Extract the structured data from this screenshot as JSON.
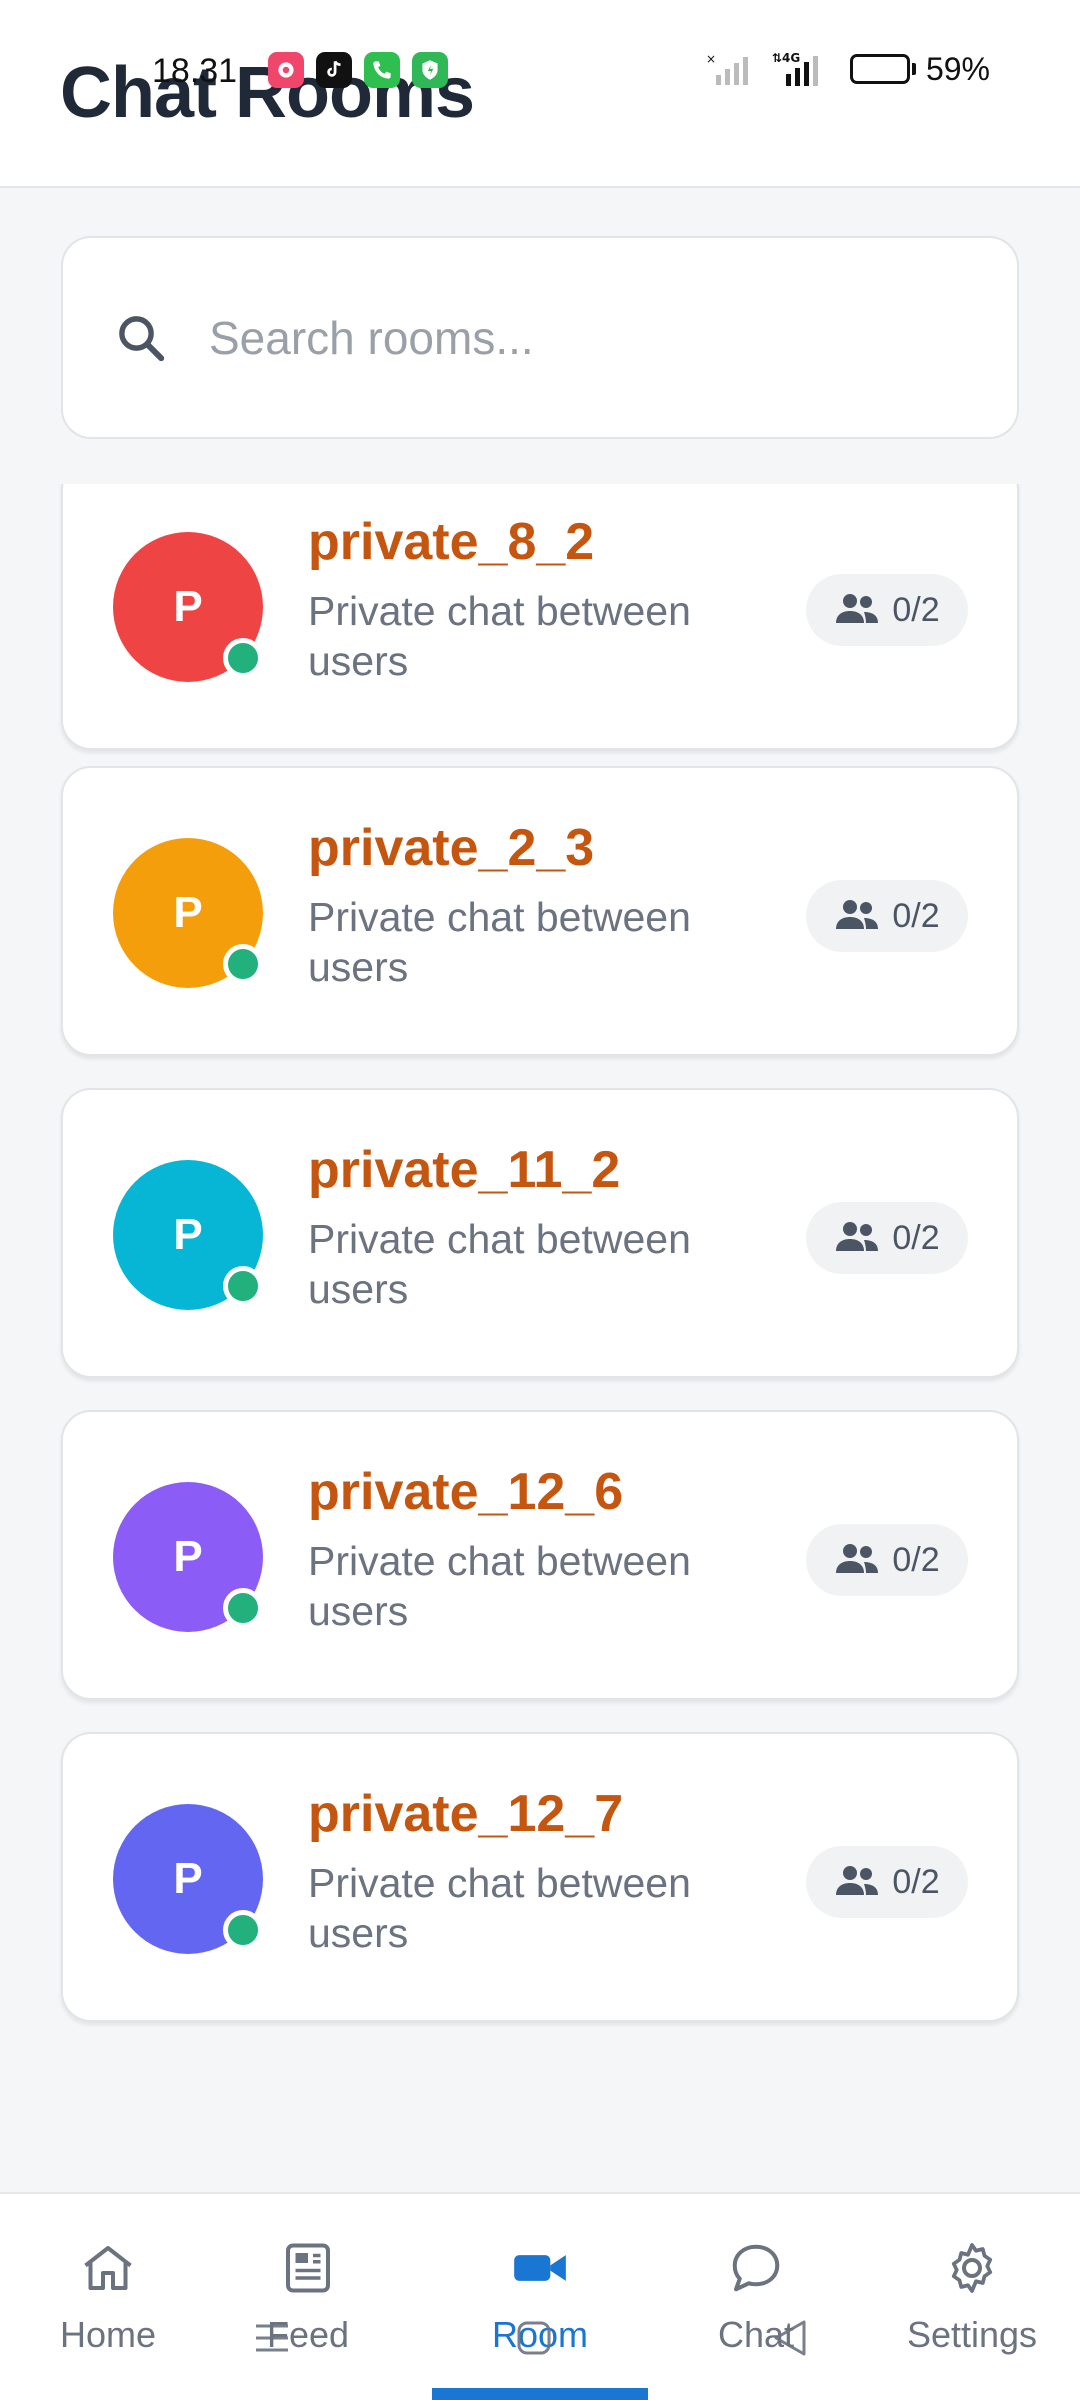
{
  "status_bar": {
    "time": "18.31",
    "battery_percent": "59%",
    "battery_level": 0.59
  },
  "header": {
    "title": "Chat Rooms"
  },
  "search": {
    "placeholder": "Search rooms..."
  },
  "rooms": [
    {
      "name": "private_8_2",
      "initial": "P",
      "description": "Private chat between users",
      "members": "0/2",
      "avatar_color": "#ef4444",
      "online": true
    },
    {
      "name": "private_2_3",
      "initial": "P",
      "description": "Private chat between users",
      "members": "0/2",
      "avatar_color": "#f59e0b",
      "online": true
    },
    {
      "name": "private_11_2",
      "initial": "P",
      "description": "Private chat between users",
      "members": "0/2",
      "avatar_color": "#06b6d4",
      "online": true
    },
    {
      "name": "private_12_6",
      "initial": "P",
      "description": "Private chat between users",
      "members": "0/2",
      "avatar_color": "#8b5cf6",
      "online": true
    },
    {
      "name": "private_12_7",
      "initial": "P",
      "description": "Private chat between users",
      "members": "0/2",
      "avatar_color": "#6366f1",
      "online": true
    }
  ],
  "nav": {
    "items": [
      {
        "label": "Home",
        "icon": "home-icon"
      },
      {
        "label": "Feed",
        "icon": "newspaper-icon"
      },
      {
        "label": "Room",
        "icon": "video-camera-icon",
        "active": true
      },
      {
        "label": "Chat",
        "icon": "chat-bubble-icon"
      },
      {
        "label": "Settings",
        "icon": "gear-icon"
      }
    ]
  },
  "colors": {
    "accent": "#1976d2",
    "room_name": "#c4560f",
    "online": "#22b07d"
  }
}
